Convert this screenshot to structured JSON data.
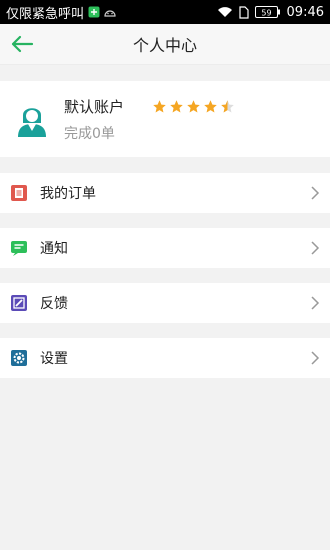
{
  "status_bar": {
    "carrier_text": "仅限紧急呼叫",
    "battery_level": "59",
    "time": "09:46"
  },
  "header": {
    "title": "个人中心"
  },
  "profile": {
    "name": "默认账户",
    "rating": 4.5,
    "rating_max": 5,
    "completed": "完成0单"
  },
  "menu": [
    {
      "label": "我的订单",
      "icon": "orders-icon",
      "color": "#e0584e"
    },
    {
      "label": "通知",
      "icon": "notification-icon",
      "color": "#2dbf5a"
    },
    {
      "label": "反馈",
      "icon": "feedback-icon",
      "color": "#5b4bb7"
    },
    {
      "label": "设置",
      "icon": "settings-icon",
      "color": "#1f6e99"
    }
  ],
  "colors": {
    "accent": "#27b361",
    "star": "#f5a623"
  }
}
